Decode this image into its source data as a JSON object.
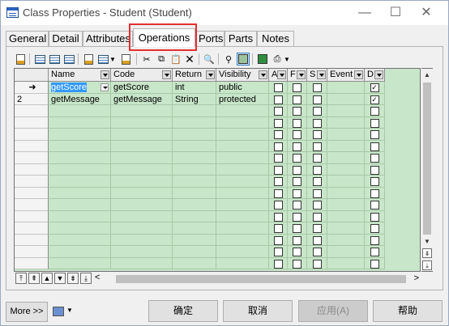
{
  "window": {
    "title": "Class Properties - Student (Student)",
    "minimize_glyph": "—",
    "maximize_glyph": "☐",
    "close_glyph": "✕"
  },
  "tabs": [
    {
      "label": "General"
    },
    {
      "label": "Detail"
    },
    {
      "label": "Attributes"
    },
    {
      "label": "Operations",
      "active": true
    },
    {
      "label": "Ports"
    },
    {
      "label": "Parts"
    },
    {
      "label": "Notes"
    }
  ],
  "toolbar": {
    "icons": [
      "properties-icon",
      "add-row-icon",
      "insert-row-icon",
      "add-rows-icon",
      "filter-list-icon",
      "add-objects-icon",
      "cut-icon",
      "copy-icon",
      "paste-icon",
      "delete-icon",
      "find-icon",
      "customize-columns-icon",
      "filter-icon",
      "excel-export-icon",
      "print-icon"
    ]
  },
  "grid": {
    "columns": [
      {
        "label": "Name"
      },
      {
        "label": "Code"
      },
      {
        "label": "Return"
      },
      {
        "label": "Visibility"
      },
      {
        "label": "A"
      },
      {
        "label": "F"
      },
      {
        "label": "S"
      },
      {
        "label": "Event"
      },
      {
        "label": "D"
      }
    ],
    "row_marker_current": "➜",
    "rows": [
      {
        "number": "",
        "name": "getScore",
        "code": "getScore",
        "return": "int",
        "visibility": "public",
        "a": false,
        "f": false,
        "s": false,
        "event": "",
        "d": true
      },
      {
        "number": "2",
        "name": "getMessage",
        "code": "getMessage",
        "return": "String",
        "visibility": "protected",
        "a": false,
        "f": false,
        "s": false,
        "event": "",
        "d": true
      }
    ],
    "empty_row_count": 14
  },
  "navigation": {
    "buttons": [
      "⤒",
      "⇞",
      "▲",
      "▼",
      "⇟",
      "⤓"
    ],
    "scroll_left": "<",
    "scroll_right": ">"
  },
  "footer": {
    "more": "More >>",
    "ok": "确定",
    "cancel": "取消",
    "apply": "应用(A)",
    "help": "帮助"
  }
}
